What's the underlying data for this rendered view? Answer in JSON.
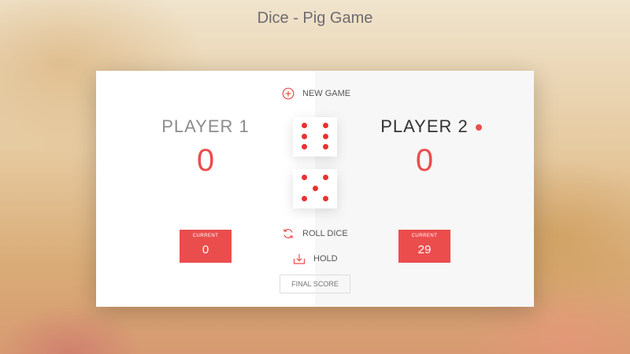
{
  "header": {
    "title": "Dice - Pig Game"
  },
  "players": [
    {
      "name": "Player 1",
      "score": "0",
      "current_label": "Current",
      "current_score": "0",
      "active": false
    },
    {
      "name": "Player 2",
      "score": "0",
      "current_label": "Current",
      "current_score": "29",
      "active": true
    }
  ],
  "controls": {
    "new_game": {
      "label": "New game",
      "icon": "add-circle-icon"
    },
    "roll_dice": {
      "label": "Roll dice",
      "icon": "refresh-icon"
    },
    "hold": {
      "label": "Hold",
      "icon": "download-icon"
    },
    "final_score": {
      "placeholder": "Final score",
      "value": ""
    }
  },
  "dice": [
    {
      "value": 6
    },
    {
      "value": 5
    }
  ],
  "colors": {
    "accent": "#eb4d4d",
    "active_panel": "#f7f7f7",
    "panel": "#ffffff",
    "title_text": "#6e6a70"
  }
}
